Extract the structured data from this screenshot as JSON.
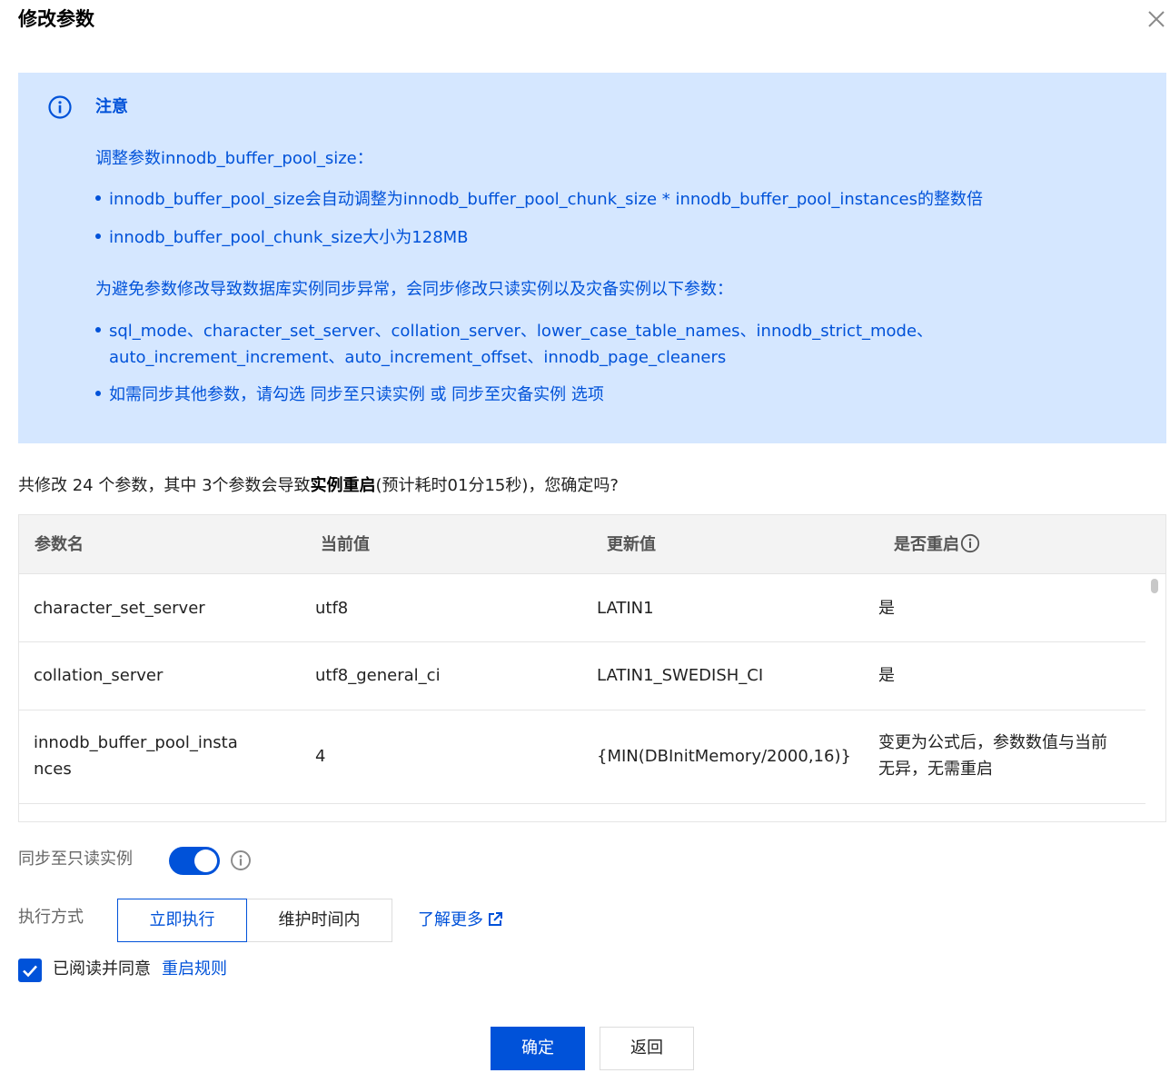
{
  "dialog": {
    "title": "修改参数",
    "close_icon": "close-icon"
  },
  "notice": {
    "icon": "info-circle-icon",
    "title": "注意",
    "para1": "调整参数innodb_buffer_pool_size：",
    "bullets1": [
      "innodb_buffer_pool_size会自动调整为innodb_buffer_pool_chunk_size * innodb_buffer_pool_instances的整数倍",
      "innodb_buffer_pool_chunk_size大小为128MB"
    ],
    "para2": "为避免参数修改导致数据库实例同步异常，会同步修改只读实例以及灾备实例以下参数：",
    "bullet_params_line1": "sql_mode、character_set_server、collation_server、lower_case_table_names、innodb_strict_mode、",
    "bullet_params_line2": "auto_increment_increment、auto_increment_offset、innodb_page_cleaners",
    "bullet_sync": "如需同步其他参数，请勾选 同步至只读实例 或 同步至灾备实例 选项"
  },
  "summary": {
    "prefix": "共修改 24 个参数，其中 3个参数会导致",
    "bold": "实例重启",
    "suffix": "(预计耗时01分15秒)，您确定吗?"
  },
  "table": {
    "headers": {
      "name": "参数名",
      "current": "当前值",
      "updated": "更新值",
      "restart": "是否重启"
    },
    "rows": [
      {
        "name_line1": "character_set_server",
        "name_line2": "",
        "current": "utf8",
        "updated": "LATIN1",
        "restart_line1": "是",
        "restart_line2": ""
      },
      {
        "name_line1": "collation_server",
        "name_line2": "",
        "current": "utf8_general_ci",
        "updated": "LATIN1_SWEDISH_CI",
        "restart_line1": "是",
        "restart_line2": ""
      },
      {
        "name_line1": "innodb_buffer_pool_insta",
        "name_line2": "nces",
        "current": "4",
        "updated": "{MIN(DBInitMemory/2000,16)}",
        "restart_line1": "变更为公式后，参数数值与当前",
        "restart_line2": "无异，无需重启"
      }
    ]
  },
  "sync": {
    "label": "同步至只读实例",
    "enabled": true
  },
  "execution": {
    "label": "执行方式",
    "options": [
      "立即执行",
      "维护时间内"
    ],
    "selected": "立即执行",
    "learn_more": "了解更多"
  },
  "agreement": {
    "checked": true,
    "text": "已阅读并同意",
    "link": "重启规则"
  },
  "footer": {
    "confirm": "确定",
    "back": "返回"
  },
  "colors": {
    "primary": "#0052d9",
    "notice_bg": "#d5e7ff",
    "header_bg": "#f3f3f3",
    "border": "#e5e5e5"
  }
}
